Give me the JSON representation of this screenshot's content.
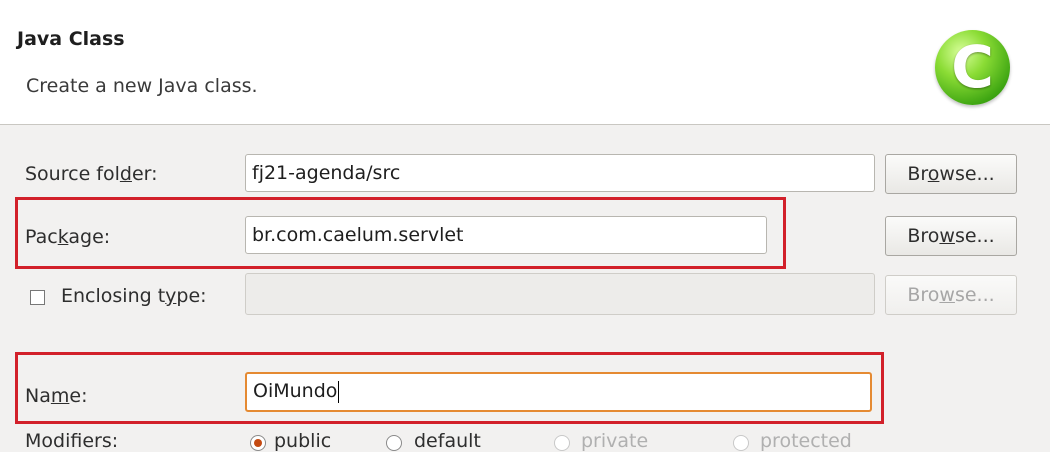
{
  "header": {
    "title": "Java Class",
    "description": "Create a new Java class.",
    "icon_letter": "C",
    "icon_name": "java-class-icon"
  },
  "form": {
    "source_folder": {
      "label_pre": "Source fol",
      "label_mnemonic": "d",
      "label_post": "er:",
      "value": "fj21-agenda/src",
      "browse_pre": "Br",
      "browse_mnemonic": "o",
      "browse_post": "wse..."
    },
    "package": {
      "label_pre": "Pac",
      "label_mnemonic": "k",
      "label_post": "age:",
      "value": "br.com.caelum.servlet",
      "browse_pre": "Bro",
      "browse_mnemonic": "w",
      "browse_post": "se..."
    },
    "enclosing_type": {
      "label_pre": "Enclosing t",
      "label_mnemonic": "y",
      "label_post": "pe:",
      "value": "",
      "checked": false,
      "browse_pre": "Bro",
      "browse_mnemonic": "w",
      "browse_post": "se..."
    },
    "name": {
      "label_pre": "Na",
      "label_mnemonic": "m",
      "label_post": "e:",
      "value": "OiMundo"
    },
    "modifiers": {
      "label": "Modifiers:",
      "options": [
        {
          "label": "public",
          "selected": true,
          "enabled": true
        },
        {
          "label": "default",
          "selected": false,
          "enabled": true
        },
        {
          "label": "private",
          "selected": false,
          "enabled": false
        },
        {
          "label": "protected",
          "selected": false,
          "enabled": false
        }
      ]
    }
  },
  "colors": {
    "highlight": "#d2202a",
    "focus_border": "#e58a32"
  }
}
